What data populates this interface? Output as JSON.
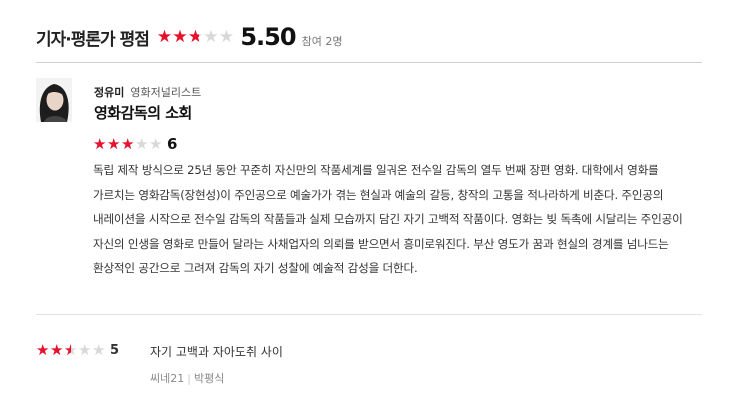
{
  "header": {
    "title": "기자·평론가 평점",
    "avg_rating_fraction": 0.55,
    "avg_score": "5.50",
    "participants": "참여 2명"
  },
  "colors": {
    "star_filled": "#e8112d",
    "star_empty": "#d8d8d8"
  },
  "review": {
    "critic_name": "정유미",
    "critic_role": "영화저널리스트",
    "title": "영화감독의 소회",
    "rating_fraction": 0.6,
    "score": "6",
    "body": "독립 제작 방식으로 25년 동안 꾸준히 자신만의 작품세계를 일궈온 전수일 감독의 열두 번째 장편 영화. 대학에서 영화를 가르치는 영화감독(장현성)이 주인공으로 예술가가 겪는 현실과 예술의 갈등, 창작의 고통을 적나라하게 비춘다. 주인공의 내레이션을 시작으로 전수일 감독의 작품들과 실제 모습까지 담긴 자기 고백적 작품이다. 영화는 빚 독촉에 시달리는 주인공이 자신의 인생을 영화로 만들어 달라는 사채업자의 의뢰를 받으면서 흥미로워진다. 부산 영도가 꿈과 현실의 경계를 넘나드는 환상적인 공간으로 그려져 감독의 자기 성찰에 예술적 감성을 더한다."
  },
  "second_review": {
    "rating_fraction": 0.5,
    "score": "5",
    "title": "자기 고백과 자아도취 사이",
    "outlet": "씨네21",
    "separator": "|",
    "critic_name": "박평식"
  }
}
